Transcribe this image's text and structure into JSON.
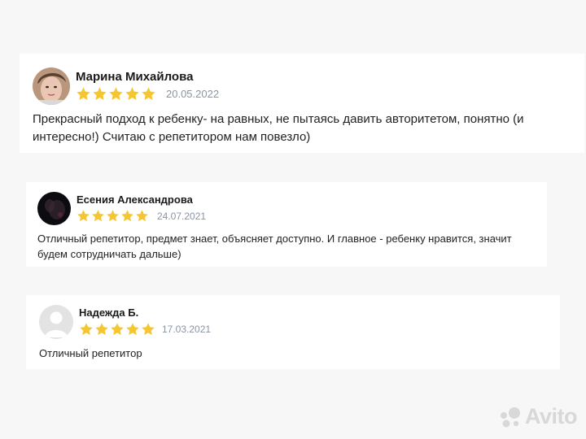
{
  "reviews": [
    {
      "author": "Марина Михайлова",
      "avatar": "photo-avatar",
      "rating": 5,
      "date": "20.05.2022",
      "text": "Прекрасный подход к ребенку- на равных, не пытаясь давить авторитетом, понятно (и интересно!) Считаю с репетитором нам повезло)"
    },
    {
      "author": "Есения Александрова",
      "avatar": "dark-photo-avatar",
      "rating": 5,
      "date": "24.07.2021",
      "text": "Отличный репетитор, предмет знает, объясняет доступно. И главное - ребенку нравится, значит будем сотрудничать дальше)"
    },
    {
      "author": "Надежда Б.",
      "avatar": "default-user-avatar",
      "rating": 5,
      "date": "17.03.2021",
      "text": "Отличный репетитор"
    }
  ],
  "watermark": {
    "text": "Avito",
    "icon": "avito-dots-icon"
  },
  "colors": {
    "star": "#f6c631",
    "date": "#8a94a3",
    "background": "#f7f7f8",
    "card": "#ffffff"
  }
}
